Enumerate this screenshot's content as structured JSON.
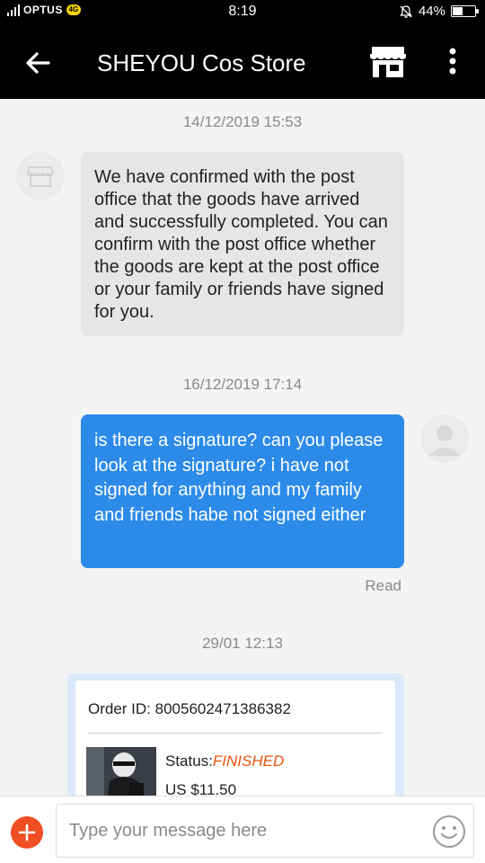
{
  "status_bar": {
    "carrier": "OPTUS",
    "carrier_badge": "4G",
    "time": "8:19",
    "battery": "44%",
    "battery_level": 0.44
  },
  "app_bar": {
    "title": "SHEYOU Cos Store",
    "icons": [
      "back-arrow-icon",
      "store-icon",
      "more-vertical-icon"
    ]
  },
  "chat": {
    "messages": [
      {
        "timestamp": "14/12/2019 15:53",
        "sender": "store",
        "text": "We have confirmed with the post office that the goods have arrived and successfully completed. You can confirm with the post office whether the goods are kept at the post office or your family or friends have signed for you."
      },
      {
        "timestamp": "16/12/2019 17:14",
        "sender": "user",
        "text": "is there a signature? can you please look at the signature? i have not signed for anything and my family and friends habe not signed either",
        "status": "Read"
      },
      {
        "timestamp": "29/01 12:13",
        "sender": "user",
        "order": {
          "id_label": "Order ID: 8005602471386382",
          "status_label": "Status:",
          "status_value": "FINISHED",
          "price": "US $11.50"
        }
      }
    ]
  },
  "input_bar": {
    "placeholder": "Type your message here",
    "value": "",
    "accent": "#f04e23"
  },
  "colors": {
    "outgoing_bubble": "#2c8be8",
    "incoming_bubble": "#e6e6e6",
    "status_finished": "#e8540e"
  }
}
